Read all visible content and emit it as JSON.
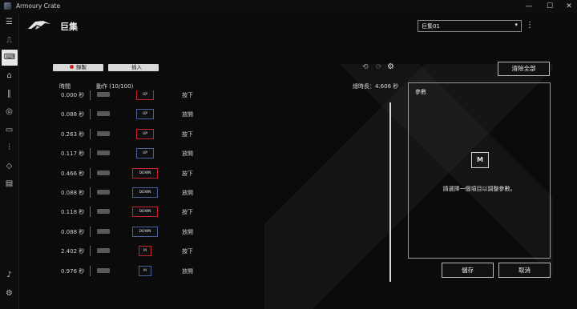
{
  "window": {
    "title": "Armoury Crate",
    "minimize": "—",
    "maximize": "☐",
    "close": "✕"
  },
  "sidebar": {
    "icons": [
      "menu-icon",
      "device-icon",
      "keyboard-icon",
      "aura-icon",
      "armoury-icon",
      "scenario-icon",
      "media-icon",
      "equalizer-icon",
      "deals-icon",
      "news-icon",
      "notification-icon",
      "settings-icon"
    ]
  },
  "header": {
    "title": "巨集",
    "macro_selected": "巨集01",
    "chevron": "▾",
    "more": "⋮"
  },
  "toolbar": {
    "record_label": "錄製",
    "insert_label": "插入",
    "clear_label": "清除全部",
    "undo": "⟲",
    "redo": "⟳",
    "gear": "⚙"
  },
  "list": {
    "col_time": "時間",
    "col_action": "動作 (10/100)",
    "total_label": "總時長：4.606 秒",
    "rows": [
      {
        "time": "0.000 秒",
        "key": "UP",
        "action": "按下",
        "pressed": true
      },
      {
        "time": "0.088 秒",
        "key": "UP",
        "action": "放開",
        "pressed": false
      },
      {
        "time": "0.263 秒",
        "key": "UP",
        "action": "按下",
        "pressed": true
      },
      {
        "time": "0.117 秒",
        "key": "UP",
        "action": "放開",
        "pressed": false
      },
      {
        "time": "0.466 秒",
        "key": "DOWN",
        "action": "按下",
        "pressed": true
      },
      {
        "time": "0.088 秒",
        "key": "DOWN",
        "action": "放開",
        "pressed": false
      },
      {
        "time": "0.118 秒",
        "key": "DOWN",
        "action": "按下",
        "pressed": true
      },
      {
        "time": "0.088 秒",
        "key": "DOWN",
        "action": "放開",
        "pressed": false
      },
      {
        "time": "2.402 秒",
        "key": "M",
        "action": "按下",
        "pressed": true
      },
      {
        "time": "0.976 秒",
        "key": "M",
        "action": "放開",
        "pressed": false
      }
    ]
  },
  "params": {
    "title": "參數",
    "icon_letter": "M",
    "hint": "請選擇一個項目以調整參數。"
  },
  "footer": {
    "save_label": "儲存",
    "cancel_label": "取消"
  },
  "colors": {
    "pressed_border": "#c0262a",
    "released_border": "#4a5f9e",
    "accent": "#d62020"
  }
}
